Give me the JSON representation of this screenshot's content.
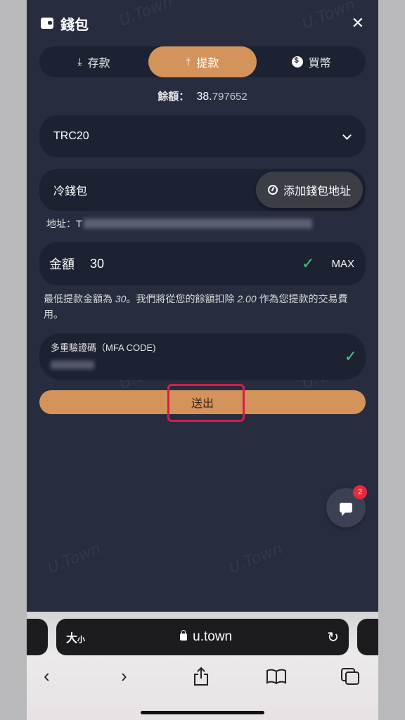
{
  "header": {
    "title": "錢包",
    "close": "✕"
  },
  "tabs": [
    {
      "label": "存款",
      "icon": "download-icon",
      "active": false
    },
    {
      "label": "提款",
      "icon": "upload-icon",
      "active": true
    },
    {
      "label": "買幣",
      "icon": "coin-icon",
      "active": false
    }
  ],
  "balance": {
    "label": "餘額：",
    "whole": "38.",
    "decimals": "797652"
  },
  "network": {
    "value": "TRC20"
  },
  "wallet": {
    "value": "冷錢包",
    "add_label": "添加錢包地址"
  },
  "address": {
    "label": "地址：T"
  },
  "amount": {
    "label": "金額",
    "value": "30",
    "max": "MAX"
  },
  "note": {
    "prefix": "最低提款金額為 ",
    "min": "30",
    "mid": "。我們將從您的餘額扣除 ",
    "fee": "2.00",
    "suffix": " 作為您提款的交易費用。"
  },
  "mfa": {
    "label": "多重驗證碼（MFA CODE)"
  },
  "submit": {
    "label": "送出"
  },
  "chat": {
    "badge": "2"
  },
  "watermark": "U.Town",
  "browser": {
    "text_size": "大",
    "text_size_small": "小",
    "host": "u.town"
  },
  "colors": {
    "accent": "#d4935a",
    "panel": "#272d3f",
    "field": "#1c2232",
    "success": "#42c77f",
    "highlight": "#d61d4a"
  }
}
